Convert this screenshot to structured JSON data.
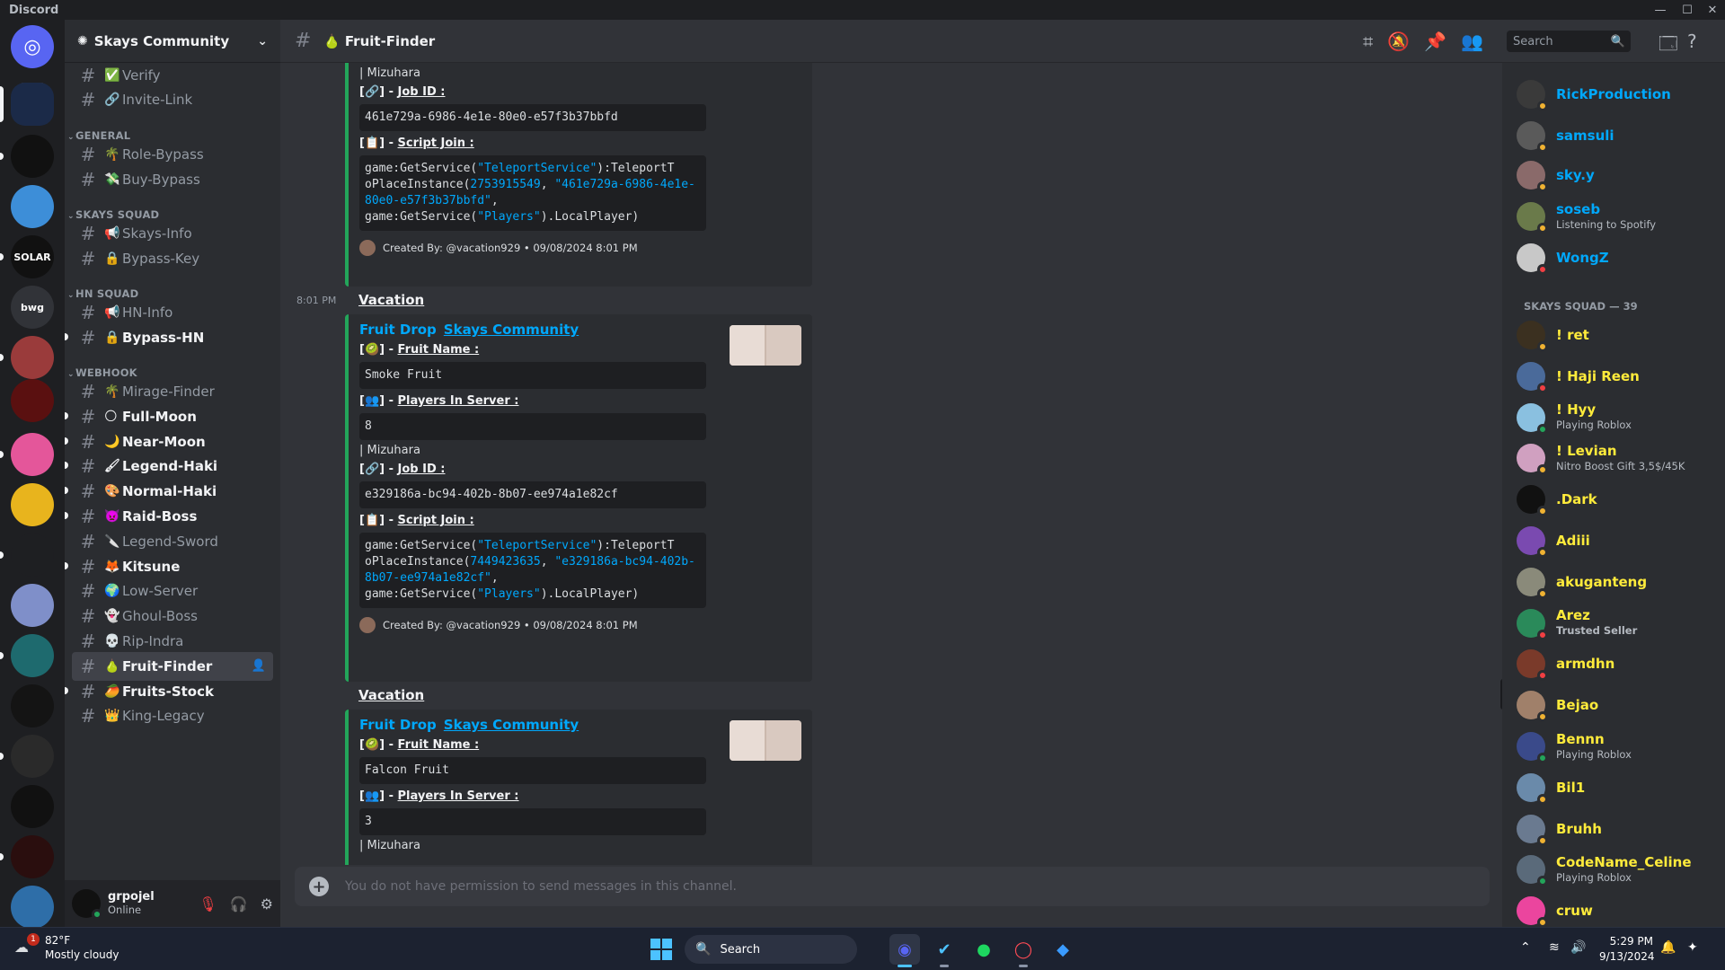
{
  "window": {
    "app_title": "Discord",
    "controls": [
      "—",
      "☐",
      "✕"
    ]
  },
  "servers": [
    {
      "icon": "discord-home-icon",
      "color": "#5865f2",
      "label": ""
    },
    {
      "icon": "server-icon-hex",
      "color": "#1b2a48",
      "label": ""
    },
    {
      "icon": "server-icon-ps",
      "color": "#111111",
      "label": ""
    },
    {
      "icon": "server-icon-blue",
      "color": "#3d8ed8",
      "label": ""
    },
    {
      "icon": "server-icon-solar",
      "color": "#111111",
      "label": "SOLAR"
    },
    {
      "icon": "server-icon-bwg",
      "color": "#313338",
      "label": "bwg"
    },
    {
      "icon": "server-icon-anime",
      "color": "#9a3b3b",
      "label": ""
    },
    {
      "icon": "server-icon-eternal",
      "color": "#5a1010",
      "label": ""
    },
    {
      "icon": "server-icon-kuromi",
      "color": "#e4569a",
      "label": ""
    },
    {
      "icon": "server-icon-pudding",
      "color": "#e8b41d",
      "label": ""
    },
    {
      "icon": "server-icon-drop",
      "color": "#1e1f22",
      "label": ""
    },
    {
      "icon": "server-icon-char",
      "color": "#7f8fc9",
      "label": ""
    },
    {
      "icon": "server-icon-teal",
      "color": "#1e6a6e",
      "label": ""
    },
    {
      "icon": "server-icon-moon",
      "color": "#141414",
      "label": ""
    },
    {
      "icon": "server-icon-solara",
      "color": "#2a2a2a",
      "label": ""
    },
    {
      "icon": "server-icon-swirl",
      "color": "#111111",
      "label": ""
    },
    {
      "icon": "server-icon-red-swirl",
      "color": "#2a0e0e",
      "label": ""
    },
    {
      "icon": "server-icon-game",
      "color": "#2e6ea8",
      "label": ""
    }
  ],
  "guild": {
    "name": "Skays Community"
  },
  "channels": {
    "top": [
      {
        "name": "Verify",
        "emoji": "✅"
      },
      {
        "name": "Invite-Link",
        "emoji": "🔗"
      }
    ],
    "general_label": "GENERAL",
    "general": [
      {
        "name": "Role-Bypass",
        "emoji": "🌴"
      },
      {
        "name": "Buy-Bypass",
        "emoji": "💸"
      }
    ],
    "squad_label": "SKAYS SQUAD",
    "squad": [
      {
        "name": "Skays-Info",
        "emoji": "📢"
      },
      {
        "name": "Bypass-Key",
        "emoji": "🔒"
      }
    ],
    "hn_label": "HN SQUAD",
    "hn": [
      {
        "name": "HN-Info",
        "emoji": "📢"
      },
      {
        "name": "Bypass-HN",
        "emoji": "🔒"
      }
    ],
    "webhook_label": "WEBHOOK",
    "webhook": [
      {
        "name": "Mirage-Finder",
        "emoji": "🌴"
      },
      {
        "name": "Full-Moon",
        "emoji": "🌕"
      },
      {
        "name": "Near-Moon",
        "emoji": "🌙"
      },
      {
        "name": "Legend-Haki",
        "emoji": "🖌"
      },
      {
        "name": "Normal-Haki",
        "emoji": "🎨"
      },
      {
        "name": "Raid-Boss",
        "emoji": "👿"
      },
      {
        "name": "Legend-Sword",
        "emoji": "🔪"
      },
      {
        "name": "Kitsune",
        "emoji": "🦊"
      },
      {
        "name": "Low-Server",
        "emoji": "🌍"
      },
      {
        "name": "Ghoul-Boss",
        "emoji": "👻"
      },
      {
        "name": "Rip-Indra",
        "emoji": "💀"
      },
      {
        "name": "Fruit-Finder",
        "emoji": "🍐"
      },
      {
        "name": "Fruits-Stock",
        "emoji": "🥭"
      },
      {
        "name": "King-Legacy",
        "emoji": "👑"
      }
    ]
  },
  "user": {
    "name": "grpojel",
    "status": "Online"
  },
  "header": {
    "channel": "🍐 Fruit-Finder",
    "search_placeholder": "Search"
  },
  "messages": {
    "m0": {
      "mizuhara": "| Mizuhara",
      "job_label": "Job ID :",
      "job_id": "461e729a-6986-4e1e-80e0-e57f3b37bbfd",
      "script_label": "Script Join :",
      "script_1": "game:GetService(",
      "script_svc": "\"TeleportService\"",
      "script_2": "):TeleportT",
      "script_3": "oPlaceInstance(",
      "script_place": "2753915549",
      "script_4": ", ",
      "script_job": "\"461e729a-6986-4e1e-80e0-e57f3b37bbfd\"",
      "script_5": ",",
      "script_6": "game:GetService(",
      "script_players": "\"Players\"",
      "script_7": ").LocalPlayer)",
      "footer": "Created By: @vacation929 • 09/08/2024 8:01 PM"
    },
    "m1": {
      "time": "8:01 PM",
      "author": "Vacation",
      "title": "Fruit Drop",
      "community": "Skays Community",
      "fruit_label": "Fruit Name :",
      "fruit": "Smoke Fruit",
      "players_label": "Players In Server :",
      "players": "8",
      "mizuhara": "| Mizuhara",
      "job_label": "Job ID :",
      "job_id": "e329186a-bc94-402b-8b07-ee974a1e82cf",
      "script_label": "Script Join :",
      "script_1": "game:GetService(",
      "script_svc": "\"TeleportService\"",
      "script_2": "):TeleportT",
      "script_3": "oPlaceInstance(",
      "script_place": "7449423635",
      "script_4": ", ",
      "script_job": "\"e329186a-bc94-402b-8b07-ee974a1e82cf\"",
      "script_5": ",",
      "script_6": "game:GetService(",
      "script_players": "\"Players\"",
      "script_7": ").LocalPlayer)",
      "footer": "Created By: @vacation929 • 09/08/2024 8:01 PM"
    },
    "m2": {
      "author": "Vacation",
      "title": "Fruit Drop",
      "community": "Skays Community",
      "fruit_label": "Fruit Name :",
      "fruit": "Falcon Fruit",
      "players_label": "Players In Server :",
      "players": "3",
      "mizuhara": "| Mizuhara"
    }
  },
  "composer": {
    "placeholder": "You do not have permission to send messages in this channel."
  },
  "members": {
    "top": [
      {
        "name": "RickProduction",
        "color": "#00a8fc",
        "sub": "",
        "av": "#3a3a3a",
        "st": "#f0b232"
      },
      {
        "name": "samsuli",
        "color": "#00a8fc",
        "sub": "",
        "av": "#5a5a5a",
        "st": "#f0b232"
      },
      {
        "name": "sky.y",
        "color": "#00a8fc",
        "sub": "",
        "av": "#8a6a6a",
        "st": "#f0b232"
      },
      {
        "name": "soseb",
        "color": "#00a8fc",
        "sub": "Listening to Spotify",
        "av": "#6a7a4a",
        "st": "#f0b232"
      },
      {
        "name": "WongZ",
        "color": "#00a8fc",
        "sub": "",
        "av": "#c8c8c8",
        "st": "#f23f43"
      }
    ],
    "squad_label": "SKAYS SQUAD — 39",
    "squad": [
      {
        "name": "! ret",
        "color": "#ffeb3b",
        "sub": "",
        "av": "#3b3020",
        "st": "#f0b232"
      },
      {
        "name": "! Haji Reen",
        "color": "#ffeb3b",
        "sub": "",
        "av": "#4a6a9a",
        "st": "#f23f43"
      },
      {
        "name": "! Hyy",
        "color": "#ffeb3b",
        "sub": "Playing Roblox",
        "av": "#8ac0e0",
        "st": "#23a55a"
      },
      {
        "name": "! Levian",
        "color": "#ffeb3b",
        "sub": "Nitro Boost Gift 3,5$/45K",
        "av": "#d0a0c0",
        "st": "#f0b232"
      },
      {
        "name": ".Dark",
        "color": "#ffeb3b",
        "sub": "",
        "av": "#111111",
        "st": "#f0b232"
      },
      {
        "name": "Adiii",
        "color": "#ffeb3b",
        "sub": "",
        "av": "#7a4ab0",
        "st": "#f0b232"
      },
      {
        "name": "akuganteng",
        "color": "#ffeb3b",
        "sub": "",
        "av": "#8a8a7a",
        "st": "#f0b232"
      },
      {
        "name": "Arez",
        "color": "#ffeb3b",
        "sub": "Trusted Seller",
        "av": "#2a8a5a",
        "st": "#f23f43"
      },
      {
        "name": "armdhn",
        "color": "#ffeb3b",
        "sub": "",
        "av": "#7a3a2a",
        "st": "#f23f43"
      },
      {
        "name": "Bejao",
        "color": "#ffeb3b",
        "sub": "",
        "av": "#a0806a",
        "st": "#f0b232"
      },
      {
        "name": "Bennn",
        "color": "#ffeb3b",
        "sub": "Playing Roblox",
        "av": "#3a4a8a",
        "st": "#23a55a"
      },
      {
        "name": "Bil1",
        "color": "#ffeb3b",
        "sub": "",
        "av": "#6a8aaa",
        "st": "#f0b232"
      },
      {
        "name": "Bruhh",
        "color": "#ffeb3b",
        "sub": "",
        "av": "#6a7a90",
        "st": "#f0b232"
      },
      {
        "name": "CodeName_Celine",
        "color": "#ffeb3b",
        "sub": "Playing Roblox",
        "av": "#5a6a7a",
        "st": "#23a55a"
      },
      {
        "name": "cruw",
        "color": "#ffeb3b",
        "sub": "",
        "av": "#eb459e",
        "st": "#f0b232"
      }
    ]
  },
  "taskbar": {
    "temp": "82°F",
    "weather": "Mostly cloudy",
    "badge": "1",
    "search": "Search",
    "time": "5:29 PM",
    "date": "9/13/2024"
  }
}
